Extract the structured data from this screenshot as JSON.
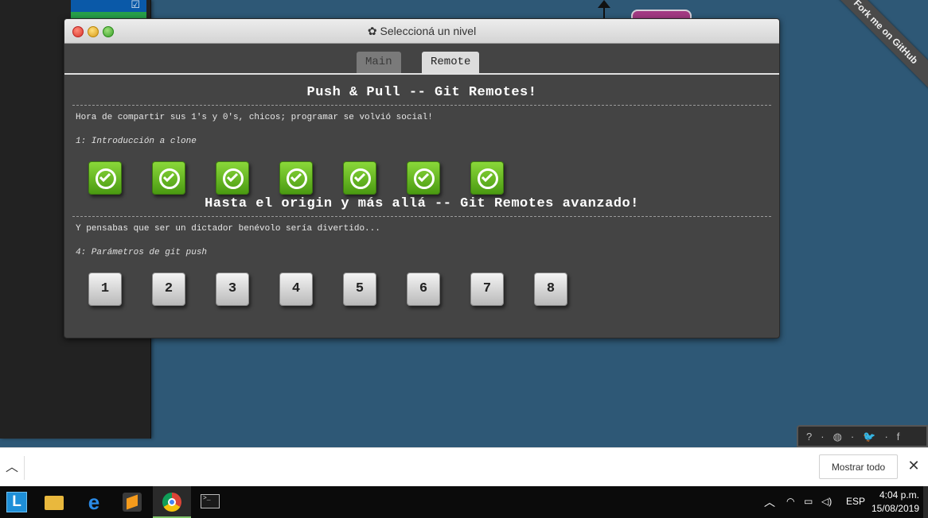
{
  "modal": {
    "title": "Seleccioná un nivel",
    "tabs": [
      {
        "label": "Main",
        "active": false
      },
      {
        "label": "Remote",
        "active": true
      }
    ]
  },
  "sequences": [
    {
      "title": "Push & Pull -- Git Remotes!",
      "about": "Hora de compartir sus 1's y 0's, chicos; programar se volvió social!",
      "level_label": "1: Introducción a clone",
      "levels": [
        {
          "state": "completed"
        },
        {
          "state": "completed"
        },
        {
          "state": "completed"
        },
        {
          "state": "completed"
        },
        {
          "state": "completed"
        },
        {
          "state": "completed"
        },
        {
          "state": "completed"
        }
      ]
    },
    {
      "title": "Hasta el origin y más allá -- Git Remotes avanzado!",
      "about": "Y pensabas que ser un dictador benévolo sería divertido...",
      "level_label": "4: Parámetros de git push",
      "levels": [
        {
          "label": "1"
        },
        {
          "label": "2"
        },
        {
          "label": "3"
        },
        {
          "label": "4"
        },
        {
          "label": "5"
        },
        {
          "label": "6"
        },
        {
          "label": "7"
        },
        {
          "label": "8"
        }
      ]
    }
  ],
  "ribbon": {
    "text": "Fork me on GitHub"
  },
  "social": {
    "icons": [
      "help-icon",
      "globe-icon",
      "twitter-icon",
      "facebook-icon"
    ],
    "glyphs": [
      "?",
      "·",
      "◍",
      "·",
      "🐦",
      "·",
      "f"
    ]
  },
  "download_bar": {
    "show_all": "Mostrar todo"
  },
  "taskbar": {
    "language": "ESP",
    "time": "4:04 p.m.",
    "date": "15/08/2019"
  },
  "colors": {
    "background": "#2e5876",
    "modal": "#444444",
    "completed_green": "#6cc424",
    "tab_active": "#dcdcdc"
  }
}
